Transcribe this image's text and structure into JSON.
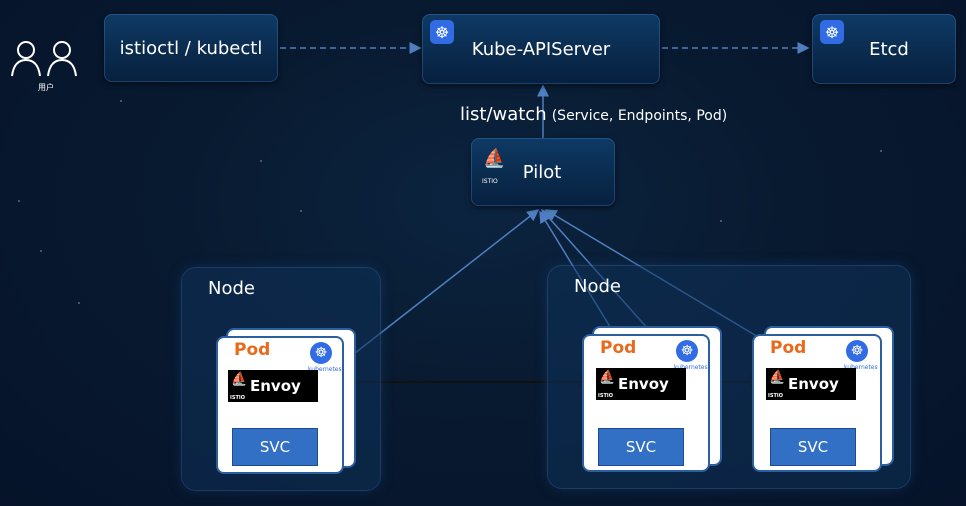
{
  "users": {
    "caption": "用户"
  },
  "cli": {
    "label": "istioctl / kubectl"
  },
  "apiserver": {
    "label": "Kube-APIServer"
  },
  "etcd": {
    "label": "Etcd"
  },
  "watch": {
    "label": "list/watch",
    "detail": "(Service, Endpoints, Pod)"
  },
  "pilot": {
    "label": "Pilot",
    "logo_text": "ISTIO"
  },
  "nodes": [
    {
      "label": "Node",
      "pods": [
        {
          "pod": "Pod",
          "envoy": "Envoy",
          "svc": "SVC",
          "k8s_text": "kubernetes"
        }
      ]
    },
    {
      "label": "Node",
      "pods": [
        {
          "pod": "Pod",
          "envoy": "Envoy",
          "svc": "SVC",
          "k8s_text": "kubernetes"
        },
        {
          "pod": "Pod",
          "envoy": "Envoy",
          "svc": "SVC",
          "k8s_text": "kubernetes"
        }
      ]
    }
  ],
  "colors": {
    "pod_label": "#e86a1a",
    "svc_fill": "#3270c6",
    "k8s_blue": "#326ce5",
    "connector": "#4f7fc0"
  }
}
